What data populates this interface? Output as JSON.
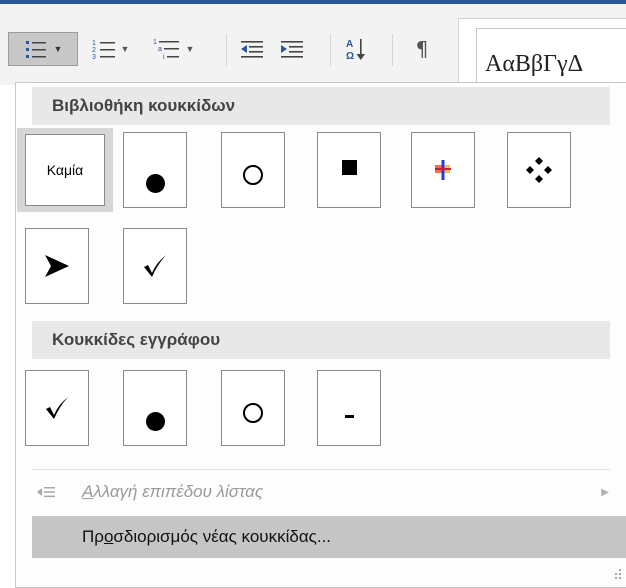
{
  "ribbon": {
    "buttons": [
      {
        "name": "bullets-button",
        "icon": "bullet-list-icon"
      },
      {
        "name": "numbering-button",
        "icon": "numbered-list-icon"
      },
      {
        "name": "multilevel-list-button",
        "icon": "multilevel-list-icon"
      },
      {
        "name": "decrease-indent-button",
        "icon": "decrease-indent-icon"
      },
      {
        "name": "increase-indent-button",
        "icon": "increase-indent-icon"
      },
      {
        "name": "sort-button",
        "icon": "sort-az-icon"
      },
      {
        "name": "show-formatting-button",
        "icon": "pilcrow-icon"
      }
    ],
    "style_sample": "AαBβΓγΔ",
    "accent_color": "#2b579a"
  },
  "menu": {
    "library_header": "Βιβλιοθήκη κουκκίδων",
    "library_items": [
      {
        "label": "Καμία",
        "kind": "none",
        "selected": true
      },
      {
        "label": "●",
        "kind": "filled-circle"
      },
      {
        "label": "○",
        "kind": "hollow-circle"
      },
      {
        "label": "■",
        "kind": "filled-square"
      },
      {
        "label": "",
        "kind": "colored-cross"
      },
      {
        "label": "❖",
        "kind": "four-diamonds"
      },
      {
        "label": "➢",
        "kind": "arrowhead"
      },
      {
        "label": "✓",
        "kind": "checkmark"
      }
    ],
    "document_header": "Κουκκίδες εγγράφου",
    "document_items": [
      {
        "label": "✓",
        "kind": "checkmark"
      },
      {
        "label": "●",
        "kind": "filled-circle"
      },
      {
        "label": "○",
        "kind": "hollow-circle"
      },
      {
        "label": "-",
        "kind": "dash"
      }
    ],
    "change_level": {
      "accesskey": "Α",
      "rest": "λλαγή επιπέδου λίστας",
      "icon": "change-list-level-icon",
      "disabled": true
    },
    "define_new": {
      "before": "Πρ",
      "accesskey": "ο",
      "after": "σδιορισμός νέας κουκκίδας...",
      "hovered": true
    }
  }
}
